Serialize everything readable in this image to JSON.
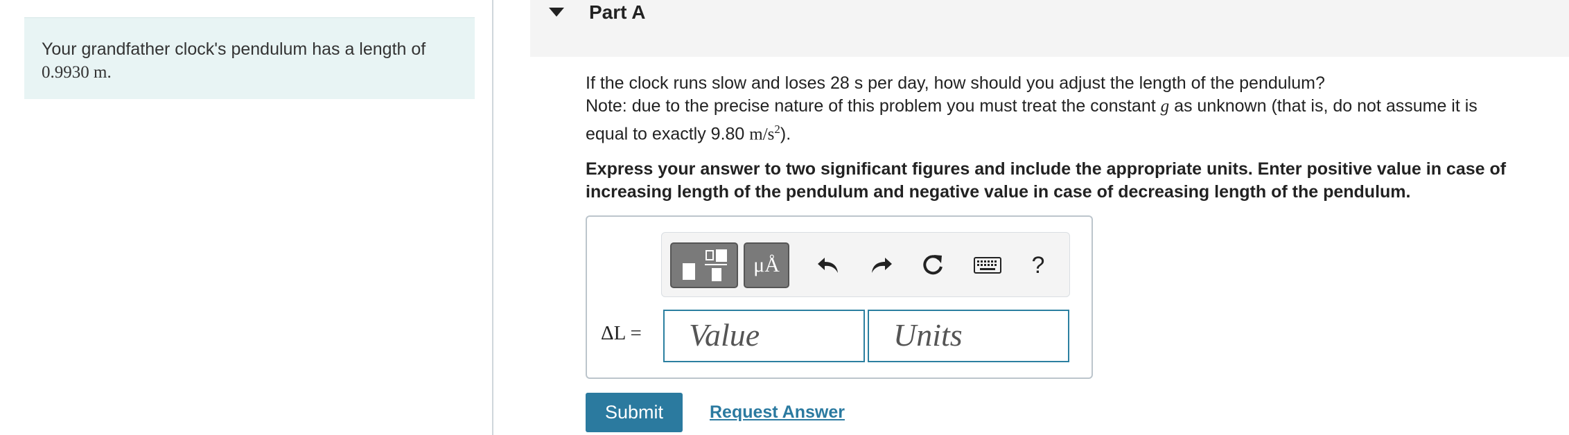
{
  "intro": {
    "text": "Your grandfather clock's pendulum has a length of",
    "value": "0.9930 m."
  },
  "part": {
    "title": "Part A"
  },
  "question": {
    "line1": "If the clock runs slow and loses 28 s per day, how should you adjust the length of the pendulum?",
    "note_before_g": "Note: due to the precise nature of this problem you must treat the constant ",
    "g_symbol": "g",
    "note_after_g": " as unknown (that is, do not assume it is",
    "line3_before": "equal to exactly 9.80 ",
    "line3_units": "m/s",
    "line3_exp": "2",
    "line3_after": ")."
  },
  "instructions": "Express your answer to two significant figures and include the appropriate units. Enter positive value in case of increasing length of the pendulum and negative value in case of decreasing length of the pendulum.",
  "toolbar": {
    "units_label": "μÅ",
    "help_label": "?"
  },
  "answer": {
    "label": "ΔL =",
    "value_placeholder": "Value",
    "units_placeholder": "Units"
  },
  "buttons": {
    "submit": "Submit",
    "request_answer": "Request Answer"
  },
  "colors": {
    "intro_bg": "#e8f4f4",
    "accent": "#2b7a9f",
    "toolbar_dark": "#7a7a7a"
  }
}
